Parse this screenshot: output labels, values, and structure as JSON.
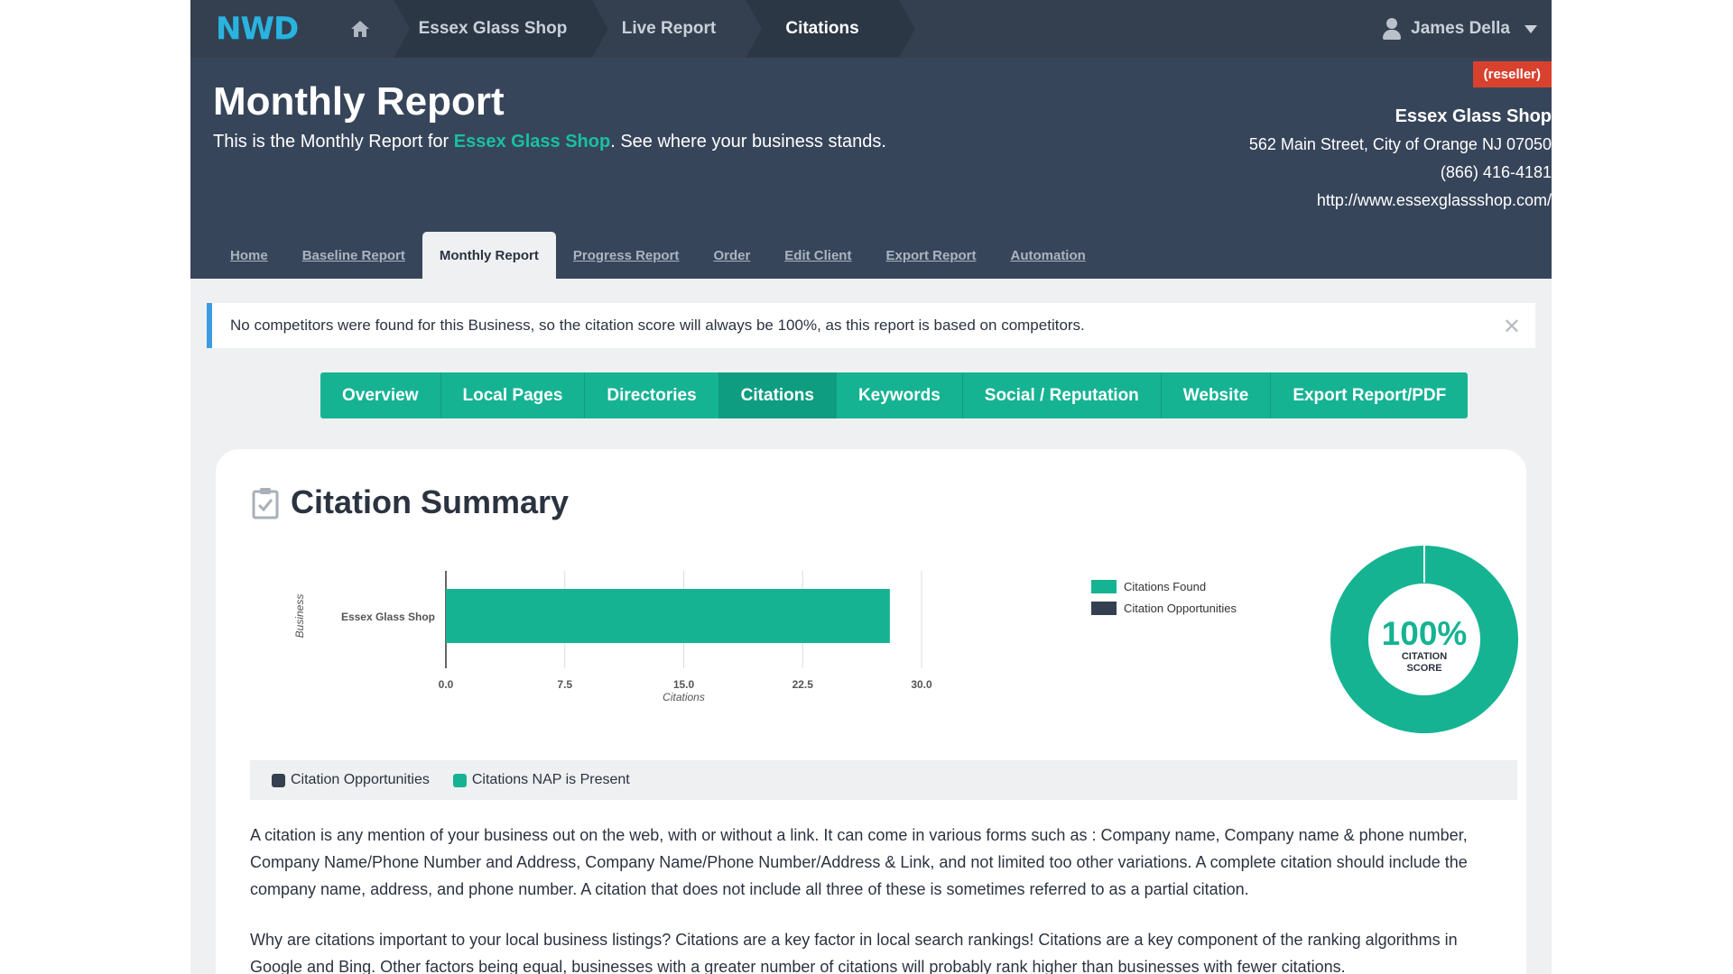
{
  "topbar": {
    "logo": "NWD",
    "breadcrumbs": [
      "Essex Glass Shop",
      "Live Report",
      "Citations"
    ],
    "user": "James Della"
  },
  "header": {
    "title": "Monthly Report",
    "subtitle_prefix": "This is the Monthly Report for ",
    "subtitle_link": "Essex Glass Shop",
    "subtitle_suffix": ". See where your business stands.",
    "badge": "(reseller)",
    "business": {
      "name": "Essex Glass Shop",
      "address": "562 Main Street, City of Orange NJ 07050",
      "phone": "(866) 416-4181",
      "website": "http://www.essexglassshop.com/"
    },
    "tabs": [
      "Home",
      "Baseline Report",
      "Monthly Report",
      "Progress Report",
      "Order",
      "Edit Client",
      "Export Report",
      "Automation"
    ],
    "active_tab": "Monthly Report"
  },
  "alert": {
    "text": "No competitors were found for this Business, so the citation score will always be 100%, as this report is based on competitors."
  },
  "section_nav": {
    "items": [
      "Overview",
      "Local Pages",
      "Directories",
      "Citations",
      "Keywords",
      "Social / Reputation",
      "Website",
      "Export Report/PDF"
    ],
    "active": "Citations"
  },
  "summary": {
    "title": "Citation Summary",
    "score_value": "100%",
    "score_label_line1": "CITATION",
    "score_label_line2": "SCORE",
    "legend_bar": [
      {
        "label": "Citation Opportunities",
        "color": "#34404f"
      },
      {
        "label": "Citations NAP is Present",
        "color": "#16b393"
      }
    ],
    "paragraph1": "A citation is any mention of your business out on the web, with or without a link. It can come in various forms such as : Company name, Company name & phone number, Company Name/Phone Number and Address, Company Name/Phone Number/Address & Link, and not limited too other variations. A complete citation should include the company name, address, and phone number. A citation that does not include all three of these is sometimes referred to as a partial citation.",
    "paragraph2": "Why are citations important to your local business listings? Citations are a key factor in local search rankings! Citations are a key component of the ranking algorithms in Google and Bing. Other factors being equal, businesses with a greater number of citations will probably rank higher than businesses with fewer citations."
  },
  "colors": {
    "accent": "#16b393",
    "dark": "#34404f",
    "header_bg": "#37455a",
    "alert_border": "#3d9be0",
    "badge": "#d9412f"
  },
  "chart_data": {
    "type": "bar",
    "orientation": "horizontal",
    "categories": [
      "Essex Glass Shop"
    ],
    "series": [
      {
        "name": "Citations Found",
        "values": [
          28
        ],
        "color": "#16b393"
      },
      {
        "name": "Citation Opportunities",
        "values": [
          0
        ],
        "color": "#34404f"
      }
    ],
    "xlabel": "Citations",
    "ylabel": "Business",
    "xlim": [
      0,
      30
    ],
    "xticks": [
      "0.0",
      "7.5",
      "15.0",
      "22.5",
      "30.0"
    ],
    "grid": true,
    "legend": "right"
  }
}
